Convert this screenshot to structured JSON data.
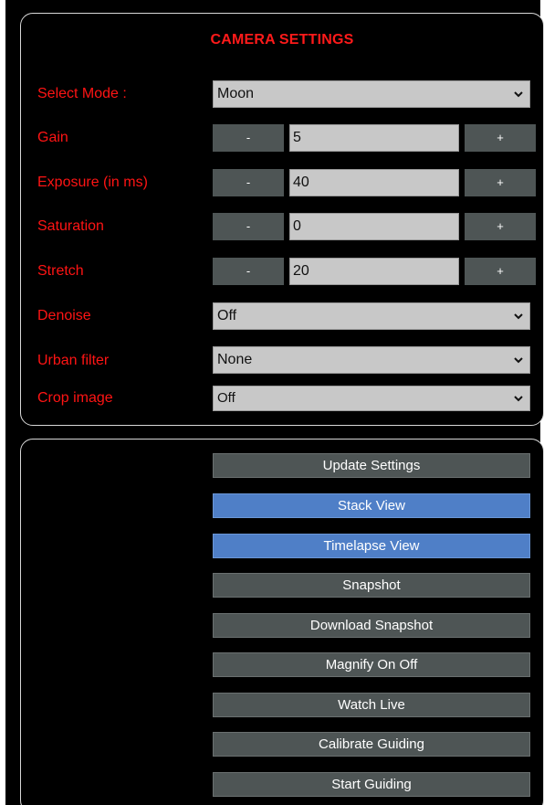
{
  "settings": {
    "title": "CAMERA SETTINGS",
    "mode": {
      "label": "Select Mode :",
      "value": "Moon"
    },
    "gain": {
      "label": "Gain",
      "value": "5",
      "minus": "-",
      "plus": "+"
    },
    "exposure": {
      "label": "Exposure (in ms)",
      "value": "40",
      "minus": "-",
      "plus": "+"
    },
    "saturation": {
      "label": "Saturation",
      "value": "0",
      "minus": "-",
      "plus": "+"
    },
    "stretch": {
      "label": "Stretch",
      "value": "20",
      "minus": "-",
      "plus": "+"
    },
    "denoise": {
      "label": "Denoise",
      "value": "Off"
    },
    "urban_filter": {
      "label": "Urban filter",
      "value": "None"
    },
    "crop_image": {
      "label": "Crop image",
      "value": "Off"
    }
  },
  "actions": {
    "update_settings": "Update Settings",
    "stack_view": "Stack View",
    "timelapse_view": "Timelapse View",
    "snapshot": "Snapshot",
    "download_snapshot": "Download Snapshot",
    "magnify": "Magnify On Off",
    "watch_live": "Watch Live",
    "calibrate_guiding": "Calibrate Guiding",
    "start_guiding": "Start Guiding"
  },
  "colors": {
    "background": "#000000",
    "label_red": "#ff1414",
    "button_gray": "#4e5555",
    "button_blue": "#4f7fc7",
    "field_gray": "#c8c8c8"
  }
}
